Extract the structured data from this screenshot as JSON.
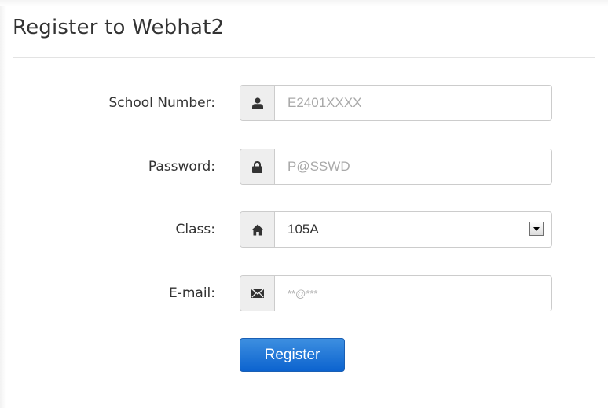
{
  "form": {
    "title": "Register to Webhat2",
    "fields": [
      {
        "label": "School Number:",
        "icon": "user-icon",
        "placeholder": "E2401XXXX",
        "value": ""
      },
      {
        "label": "Password:",
        "icon": "lock-icon",
        "placeholder": "P@SSWD",
        "value": ""
      },
      {
        "label": "Class:",
        "icon": "home-icon",
        "selected": "105A"
      },
      {
        "label": "E-mail:",
        "icon": "envelope-icon",
        "placeholder": "**@***",
        "value": ""
      }
    ],
    "submit_label": "Register"
  },
  "colors": {
    "accent": "#0c63cf",
    "addon_bg": "#eeeeee",
    "border": "#cccccc"
  }
}
